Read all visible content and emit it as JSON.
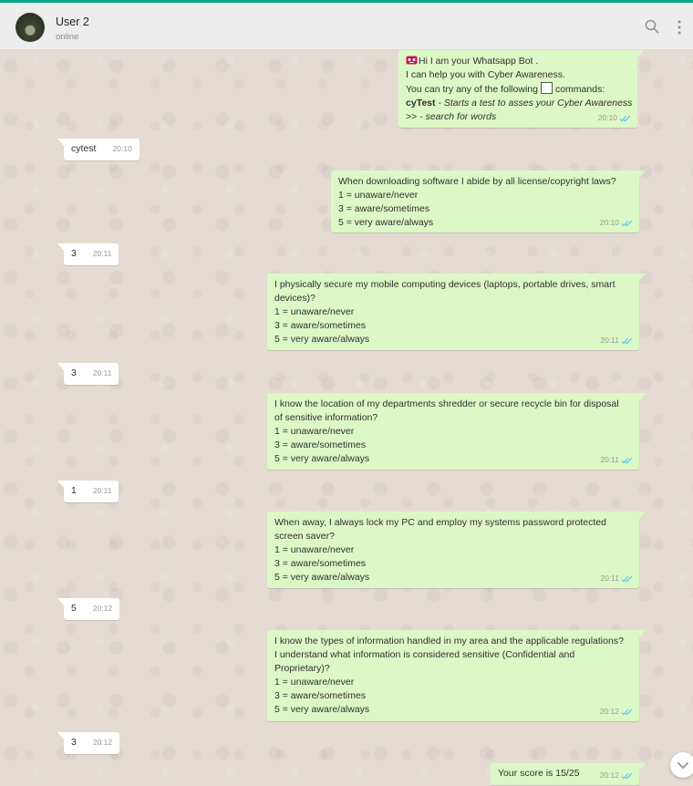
{
  "header": {
    "name": "User 2",
    "status": "online"
  },
  "colors": {
    "outgoing_bubble": "#dcf8c6",
    "incoming_bubble": "#ffffff",
    "read_ticks": "#4fc3f7",
    "accent": "#00a884"
  },
  "messages": {
    "m0": {
      "l1": "Hi I am your Whatsapp Bot .",
      "l2": "I can help you with Cyber Awareness.",
      "l3a": "You can try any of the following",
      "l3b": "commands:",
      "cmd1": "cyTest",
      "cmd1_desc": " - Starts a test to asses your Cyber Awareness",
      "cmd2": ">>",
      "cmd2_desc": " - search for words",
      "time": "20:10",
      "emoji": "robot-emoji"
    },
    "m1": {
      "text": "cytest",
      "time": "20:10"
    },
    "m2": {
      "q": "When downloading software I abide by all license/copyright laws?",
      "o1": "1 = unaware/never",
      "o3": "3 = aware/sometimes",
      "o5": "5 = very aware/always",
      "time": "20:10"
    },
    "m3": {
      "text": "3",
      "time": "20:11"
    },
    "m4": {
      "q": "I physically secure my mobile computing devices (laptops, portable drives, smart devices)?",
      "o1": "1 = unaware/never",
      "o3": "3 = aware/sometimes",
      "o5": "5 = very aware/always",
      "time": "20:11"
    },
    "m5": {
      "text": "3",
      "time": "20:11"
    },
    "m6": {
      "q": "I know the location of my departments shredder or secure recycle bin for disposal of sensitive information?",
      "o1": "1 = unaware/never",
      "o3": "3 = aware/sometimes",
      "o5": "5 = very aware/always",
      "time": "20:11"
    },
    "m7": {
      "text": "1",
      "time": "20:11"
    },
    "m8": {
      "q": "When away, I always lock my PC and employ my systems password protected screen saver?",
      "o1": "1 = unaware/never",
      "o3": "3 = aware/sometimes",
      "o5": "5 = very aware/always",
      "time": "20:11"
    },
    "m9": {
      "text": "5",
      "time": "20:12"
    },
    "m10": {
      "q": "I know the types of information handled in my area and the applicable regulations?I understand what information is considered sensitive (Confidential and Proprietary)?",
      "o1": "1 = unaware/never",
      "o3": "3 = aware/sometimes",
      "o5": "5 = very aware/always",
      "time": "20:12"
    },
    "m11": {
      "text": "3",
      "time": "20:12"
    },
    "m12": {
      "text": "Your score is 15/25",
      "time": "20:12"
    }
  },
  "icons": {
    "search": "search-icon",
    "menu": "more-vertical-icon",
    "scroll": "chevron-down-icon",
    "ticks": "double-check-icon"
  }
}
